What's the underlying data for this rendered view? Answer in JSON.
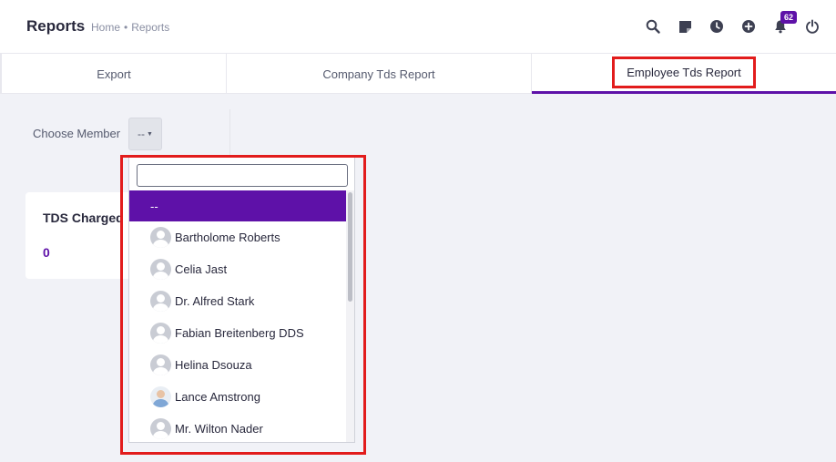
{
  "header": {
    "title": "Reports",
    "breadcrumb": {
      "home": "Home",
      "separator": "•",
      "current": "Reports"
    },
    "icons": [
      "search-icon",
      "sticky-note-icon",
      "clock-icon",
      "add-circle-icon",
      "bell-icon",
      "power-icon"
    ],
    "notification_count": "62"
  },
  "tabs": [
    {
      "label": "Export"
    },
    {
      "label": "Company Tds Report"
    },
    {
      "label": "Employee Tds Report",
      "active": true
    }
  ],
  "filter": {
    "label": "Choose Member",
    "selected": "--"
  },
  "card": {
    "title": "TDS Charged",
    "value": "0"
  },
  "dropdown": {
    "search_value": "",
    "options": [
      {
        "label": "--",
        "selected": true
      },
      {
        "label": "Bartholome Roberts"
      },
      {
        "label": "Celia Jast"
      },
      {
        "label": "Dr. Alfred Stark"
      },
      {
        "label": "Fabian Breitenberg DDS"
      },
      {
        "label": "Helina Dsouza"
      },
      {
        "label": "Lance Amstrong",
        "photo": true
      },
      {
        "label": "Mr. Wilton Nader"
      }
    ]
  },
  "colors": {
    "accent": "#5e11a8",
    "highlight": "#e21c1c",
    "icon": "#3d4052"
  }
}
